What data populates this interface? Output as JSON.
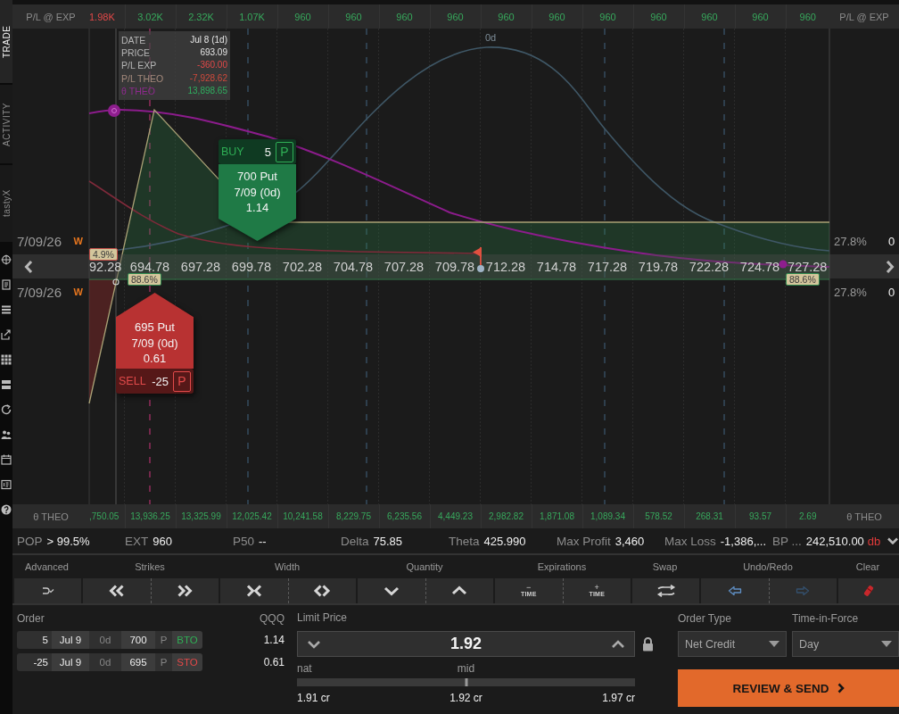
{
  "sidebar": {
    "tabs": [
      {
        "label": "TRADE",
        "selected": true
      },
      {
        "label": "ACTIVITY",
        "selected": false
      },
      {
        "label": "tastyX",
        "selected": false
      }
    ]
  },
  "pl_at_exp": {
    "label_left": "P/L @ EXP",
    "values": [
      {
        "text": "1.98K",
        "negative": true
      },
      {
        "text": "3.02K",
        "negative": false
      },
      {
        "text": "2.32K",
        "negative": false
      },
      {
        "text": "1.07K",
        "negative": false
      },
      {
        "text": "960",
        "negative": false
      },
      {
        "text": "960",
        "negative": false
      },
      {
        "text": "960",
        "negative": false
      },
      {
        "text": "960",
        "negative": false
      },
      {
        "text": "960",
        "negative": false
      },
      {
        "text": "960",
        "negative": false
      },
      {
        "text": "960",
        "negative": false
      },
      {
        "text": "960",
        "negative": false
      },
      {
        "text": "960",
        "negative": false
      },
      {
        "text": "960",
        "negative": false
      },
      {
        "text": "960",
        "negative": false
      }
    ],
    "label_right": "P/L @ EXP"
  },
  "chart": {
    "curve_label": "0d",
    "tooltip": [
      {
        "kind": "date",
        "label": "DATE",
        "value": "Jul 8 (1d)"
      },
      {
        "kind": "price",
        "label": "PRICE",
        "value": "693.09"
      },
      {
        "kind": "pl_exp",
        "label": "P/L EXP",
        "value": "-360.00"
      },
      {
        "kind": "pl_theo",
        "label": "P/L THEO",
        "value": "-7,928.62"
      },
      {
        "kind": "theta",
        "label": "θ THEO",
        "value": "13,898.65"
      }
    ],
    "orders": [
      {
        "kind": "buy",
        "action": "BUY",
        "quantity": "5",
        "option_type": "P",
        "description": "700 Put",
        "expiration": "7/09 (0d)",
        "price": "1.14"
      },
      {
        "kind": "sell",
        "action": "SELL",
        "quantity": "-25",
        "option_type": "P",
        "description": "695 Put",
        "expiration": "7/09 (0d)",
        "price": "0.61"
      }
    ],
    "expiry_rows": [
      {
        "date": "7/09/26",
        "tag": "W",
        "iv": "27.8%",
        "dte": "0"
      },
      {
        "date": "7/09/26",
        "tag": "W",
        "iv": "27.8%",
        "dte": "0"
      }
    ],
    "price_axis": [
      "92.28",
      "694.78",
      "697.28",
      "699.78",
      "702.28",
      "704.78",
      "707.28",
      "709.78",
      "712.28",
      "714.78",
      "717.28",
      "719.78",
      "722.28",
      "724.78",
      "727.28"
    ],
    "badges": [
      {
        "kind": "loss",
        "text": "4.9%"
      },
      {
        "kind": "profit",
        "text": "88.6%"
      },
      {
        "kind": "profit",
        "text": "88.6%"
      }
    ]
  },
  "theta_theo": {
    "label_left": "θ THEO",
    "values": [
      ",750.05",
      "13,936.25",
      "13,325.99",
      "12,025.42",
      "10,241.58",
      "8,229.75",
      "6,235.56",
      "4,449.23",
      "2,982.82",
      "1,871.08",
      "1,089.34",
      "578.52",
      "268.31",
      "93.57",
      "2.69"
    ],
    "label_right": "θ THEO"
  },
  "stats": [
    {
      "label": "POP",
      "value": "> 99.5%"
    },
    {
      "label": "EXT",
      "value": "960"
    },
    {
      "label": "P50",
      "value": "--"
    },
    {
      "label": "Delta",
      "value": "75.85"
    },
    {
      "label": "Theta",
      "value": "425.990"
    },
    {
      "label": "Max Profit",
      "value": "3,460"
    },
    {
      "label": "Max Loss",
      "value": "-1,386,..."
    },
    {
      "label": "BP ...",
      "value": "242,510.00",
      "suffix": "db"
    }
  ],
  "toolbar": [
    {
      "label": "Advanced",
      "buttons": [
        {
          "kind": "advanced"
        }
      ]
    },
    {
      "label": "Strikes",
      "buttons": [
        {
          "kind": "left"
        },
        {
          "kind": "right"
        }
      ]
    },
    {
      "label": "Width",
      "buttons": [
        {
          "kind": "narrow"
        },
        {
          "kind": "widen"
        }
      ]
    },
    {
      "label": "Quantity",
      "buttons": [
        {
          "kind": "down"
        },
        {
          "kind": "up"
        }
      ]
    },
    {
      "label": "Expirations",
      "buttons": [
        {
          "kind": "time",
          "sign": "−",
          "text": "TIME"
        },
        {
          "kind": "time",
          "sign": "+",
          "text": "TIME"
        }
      ]
    },
    {
      "label": "Swap",
      "buttons": [
        {
          "kind": "swap"
        }
      ]
    },
    {
      "label": "Undo/Redo",
      "buttons": [
        {
          "kind": "undo",
          "disabled": false
        },
        {
          "kind": "redo",
          "disabled": true
        }
      ]
    },
    {
      "label": "Clear",
      "buttons": [
        {
          "kind": "clear"
        }
      ]
    }
  ],
  "order": {
    "label": "Order",
    "symbol": "QQQ",
    "legs": [
      {
        "kind": "buy",
        "quantity": "5",
        "expiration": "Jul 9",
        "dte": "0d",
        "strike": "700",
        "option_type": "P",
        "action": "BTO",
        "price": "1.14"
      },
      {
        "kind": "sell",
        "quantity": "-25",
        "expiration": "Jul 9",
        "dte": "0d",
        "strike": "695",
        "option_type": "P",
        "action": "STO",
        "price": "0.61"
      }
    ]
  },
  "limit_price": {
    "label": "Limit Price",
    "value": "1.92",
    "slider": {
      "left_label": "nat",
      "mid_label": "mid",
      "level": 0.5,
      "readings": [
        "1.91 cr",
        "1.92 cr",
        "1.97 cr"
      ]
    }
  },
  "order_type": {
    "label": "Order Type",
    "value": "Net Credit"
  },
  "time_in_force": {
    "label": "Time-in-Force",
    "value": "Day"
  },
  "submit_button": "REVIEW & SEND"
}
